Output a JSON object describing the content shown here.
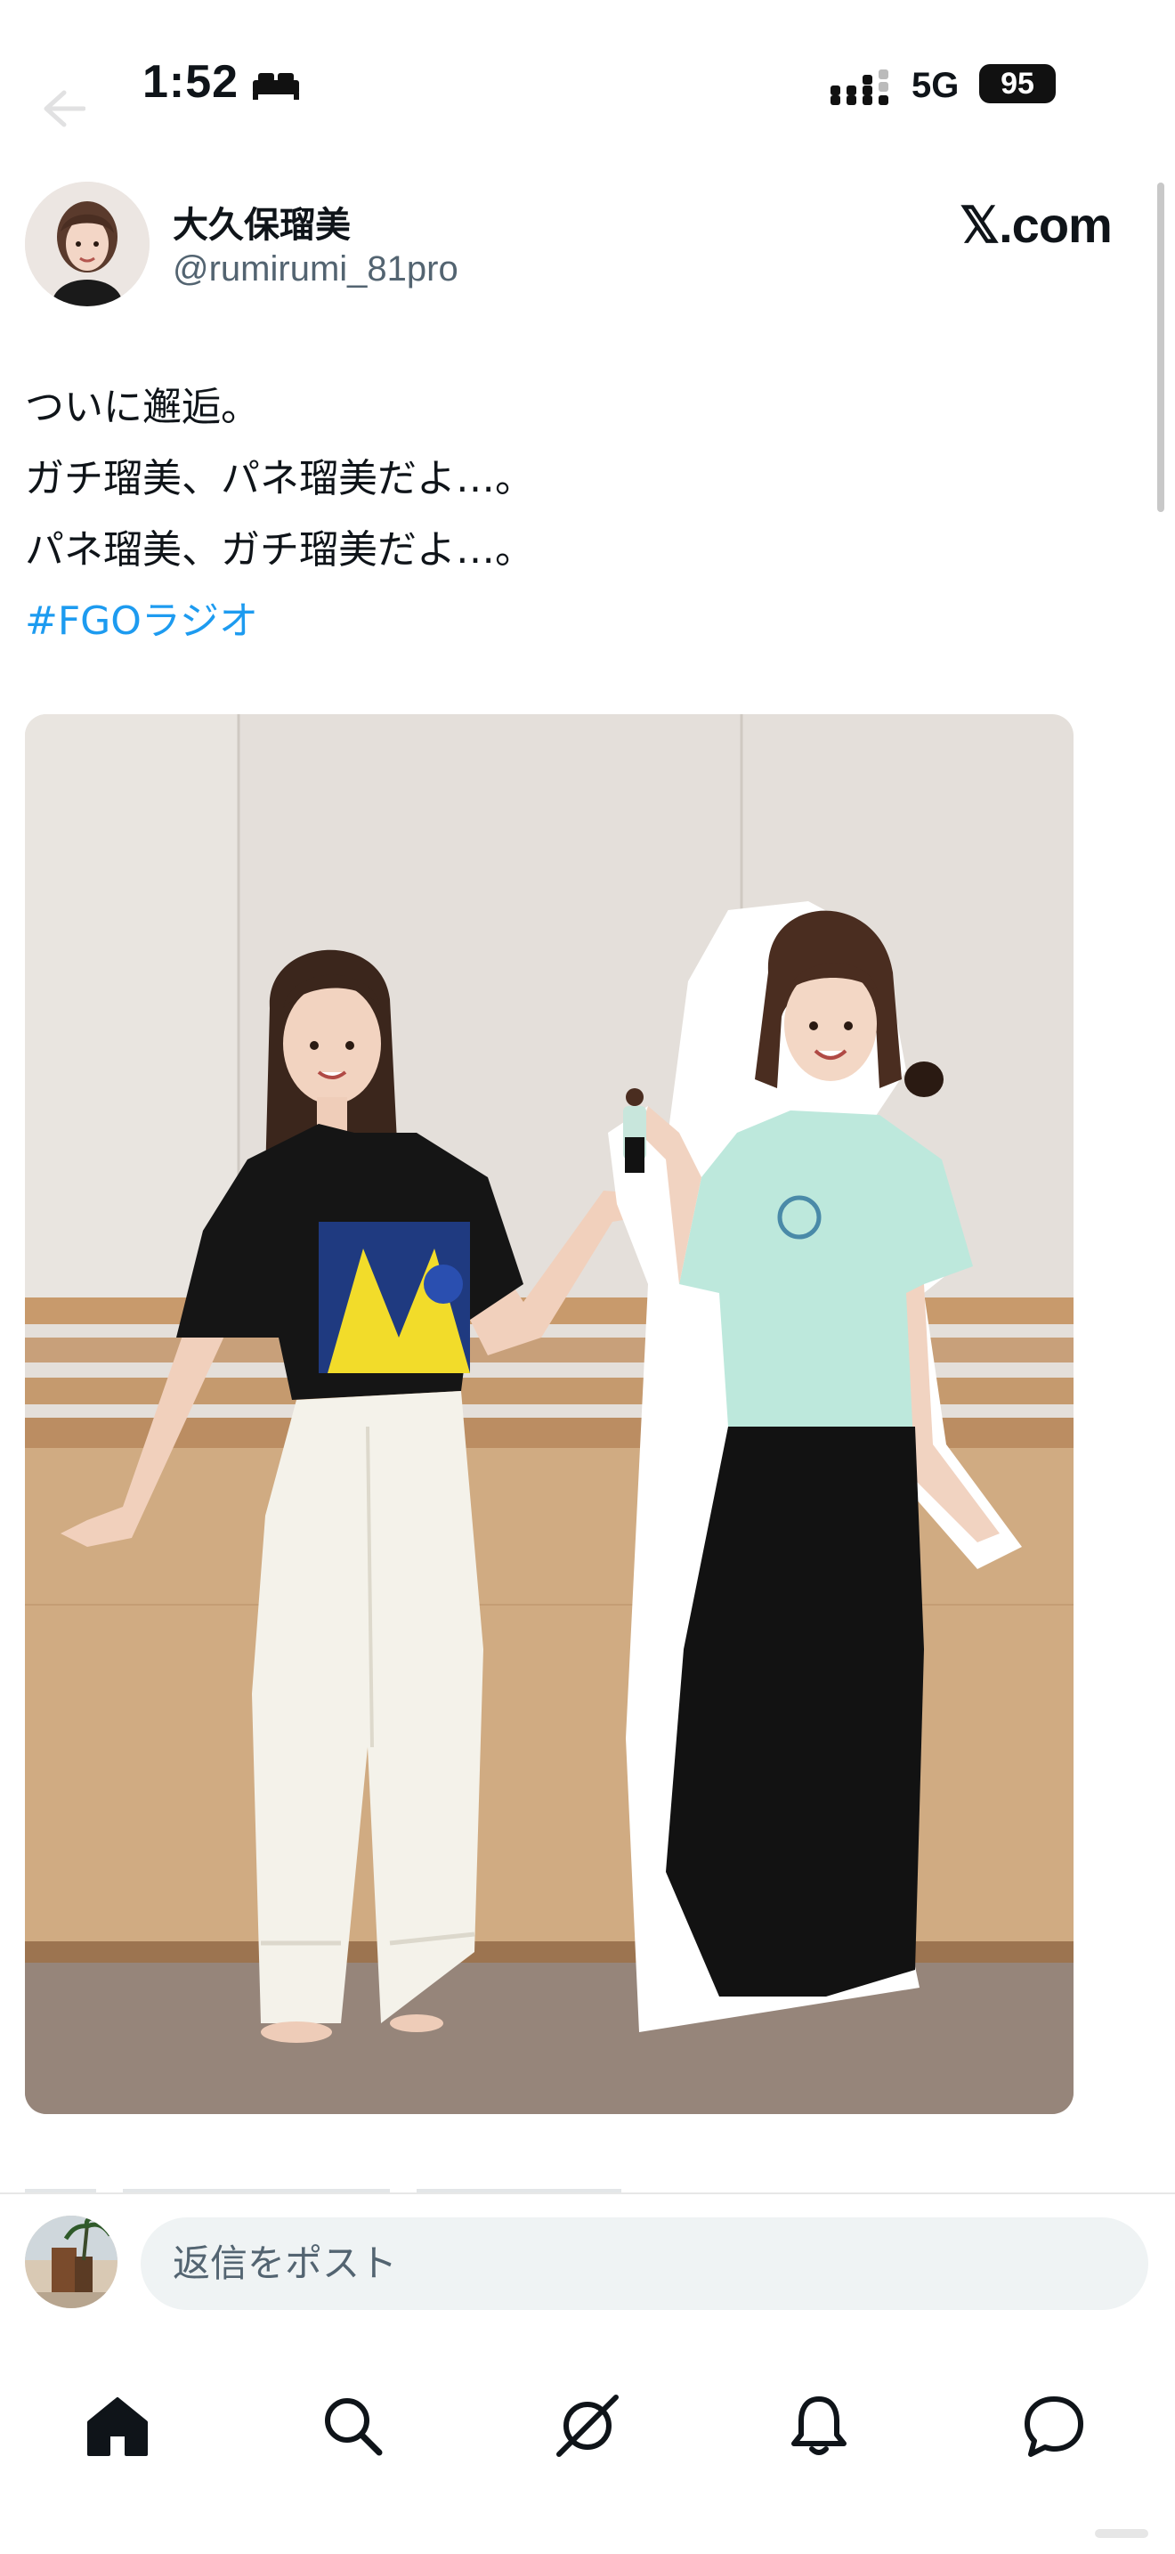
{
  "status_bar": {
    "time": "1:52",
    "network": "5G",
    "battery": "95"
  },
  "post": {
    "author": {
      "display_name": "大久保瑠美",
      "handle": "@rumirumi_81pro"
    },
    "source_label": "𝕏.com",
    "text_lines": [
      "ついに邂逅。",
      "ガチ瑠美、パネ瑠美だよ…。",
      "パネ瑠美、ガチ瑠美だよ…。"
    ],
    "hashtag": "#FGOラジオ"
  },
  "reply_bar": {
    "placeholder": "返信をポスト"
  },
  "tab_bar": {
    "tabs": [
      "home-icon",
      "search-icon",
      "grok-icon",
      "notifications-icon",
      "messages-icon"
    ]
  }
}
